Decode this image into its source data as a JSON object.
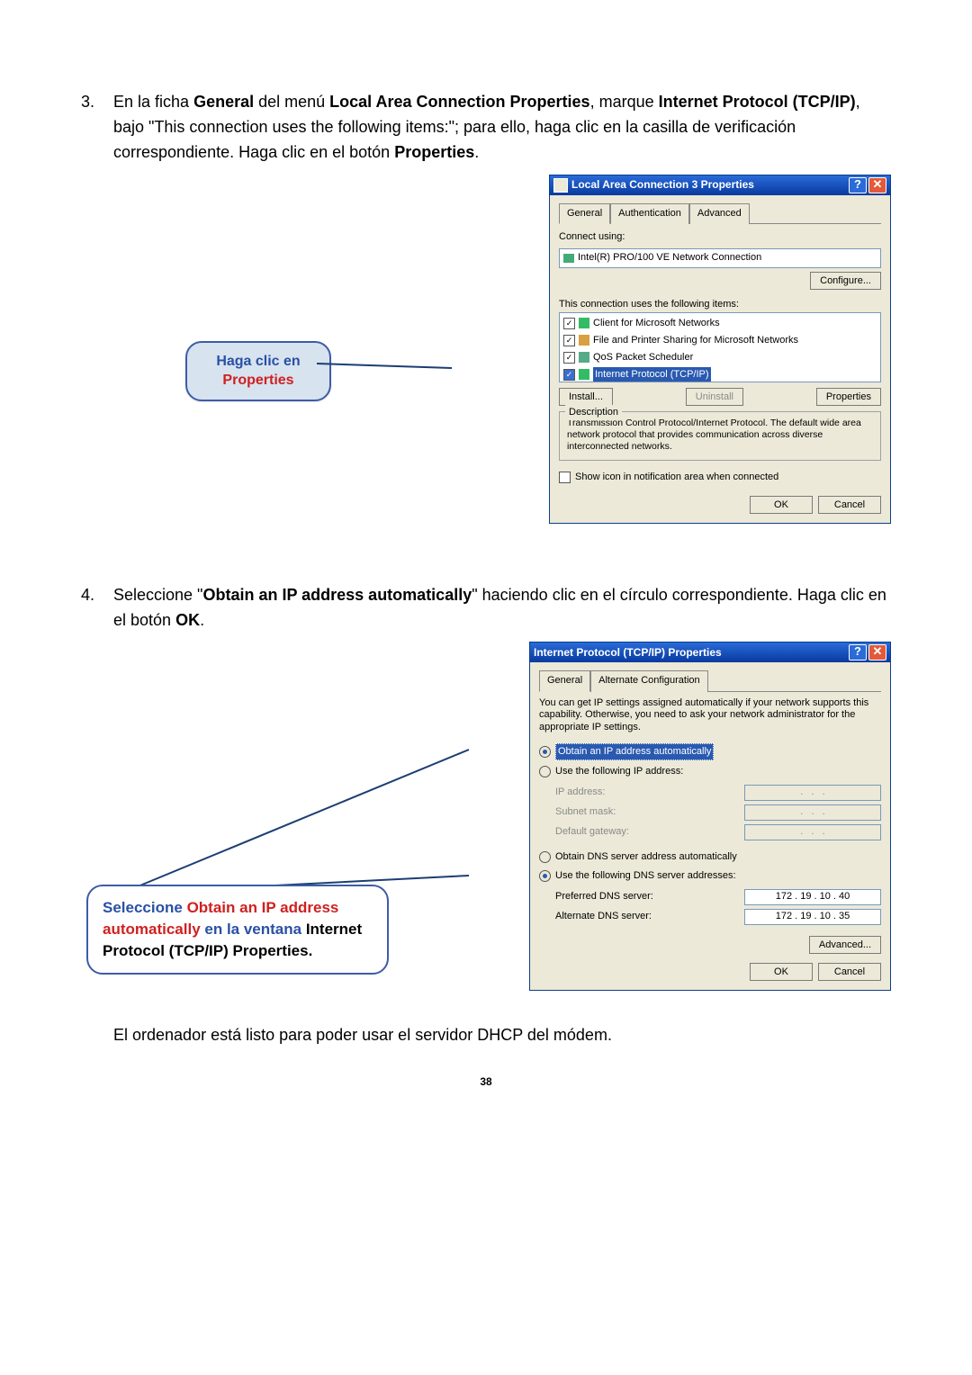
{
  "step3": {
    "number": "3.",
    "text_before_general": "En la ficha ",
    "general": "General",
    "text_del_menu": " del menú ",
    "lac_props": "Local Area Connection Properties",
    "text_marque": ", marque ",
    "ip_bold": "Internet Protocol (TCP/IP)",
    "text_bajo": ", bajo \"This connection uses the following items:\"; para ello, haga clic en la casilla de verificación correspondiente. Haga clic en el botón ",
    "properties_bold": "Properties",
    "period": "."
  },
  "callout1": {
    "line1": "Haga clic en",
    "line2": "Properties"
  },
  "dlg1": {
    "title": "Local Area Connection 3 Properties",
    "tabs": {
      "general": "General",
      "auth": "Authentication",
      "adv": "Advanced"
    },
    "connect_using": "Connect using:",
    "adapter": "Intel(R) PRO/100 VE Network Connection",
    "configure": "Configure...",
    "uses_items": "This connection uses the following items:",
    "items": {
      "i1": "Client for Microsoft Networks",
      "i2": "File and Printer Sharing for Microsoft Networks",
      "i3": "QoS Packet Scheduler",
      "i4": "Internet Protocol (TCP/IP)"
    },
    "install": "Install...",
    "uninstall": "Uninstall",
    "properties": "Properties",
    "description_legend": "Description",
    "description_text": "Transmission Control Protocol/Internet Protocol. The default wide area network protocol that provides communication across diverse interconnected networks.",
    "show_icon": "Show icon in notification area when connected",
    "ok": "OK",
    "cancel": "Cancel"
  },
  "step4": {
    "number": "4.",
    "text_before": "Seleccione \"",
    "obtain": "Obtain an IP address automatically",
    "text_after": "\" haciendo clic en el círculo correspondiente. Haga clic en el botón ",
    "ok_bold": "OK",
    "period": "."
  },
  "callout2": {
    "txt_seleccione": "Seleccione ",
    "txt_obtain": "Obtain an IP address automatically",
    "txt_en_la": " en la ventana ",
    "txt_internet": "Internet Protocol (TCP/IP) Properties",
    "period": "."
  },
  "dlg2": {
    "title": "Internet Protocol (TCP/IP) Properties",
    "tabs": {
      "general": "General",
      "alt": "Alternate Configuration"
    },
    "intro": "You can get IP settings assigned automatically if your network supports this capability. Otherwise, you need to ask your network administrator for the appropriate IP settings.",
    "r_obtain_ip": "Obtain an IP address automatically",
    "r_use_ip": "Use the following IP address:",
    "ip_address": "IP address:",
    "subnet": "Subnet mask:",
    "gateway": "Default gateway:",
    "r_obtain_dns": "Obtain DNS server address automatically",
    "r_use_dns": "Use the following DNS server addresses:",
    "pref_dns": "Preferred DNS server:",
    "alt_dns": "Alternate DNS server:",
    "pref_dns_val": "172 . 19 . 10 . 40",
    "alt_dns_val": "172 . 19 . 10 . 35",
    "advanced": "Advanced...",
    "ok": "OK",
    "cancel": "Cancel"
  },
  "closing": "El ordenador está listo para poder usar el servidor DHCP del módem.",
  "pagenum": "38"
}
